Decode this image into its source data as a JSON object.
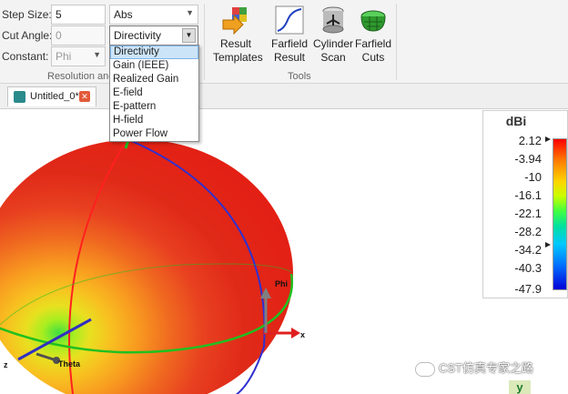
{
  "ribbon": {
    "step_size_label": "Step Size:",
    "step_size_value": "5",
    "cut_angle_label": "Cut Angle:",
    "cut_angle_value": "0",
    "constant_label": "Constant:",
    "constant_value": "Phi",
    "abs_value": "Abs",
    "quantity_value": "Directivity",
    "group_caption": "Resolution and",
    "tools_caption": "Tools",
    "tools": [
      {
        "label": "Result\nTemplates",
        "icon": "result-templates-icon"
      },
      {
        "label": "Farfield\nResult",
        "icon": "farfield-result-icon"
      },
      {
        "label": "Cylinder\nScan",
        "icon": "cylinder-scan-icon"
      },
      {
        "label": "Farfield\nCuts",
        "icon": "farfield-cuts-icon"
      }
    ]
  },
  "dropdown": {
    "options": [
      "Directivity",
      "Gain (IEEE)",
      "Realized Gain",
      "E-field",
      "E-pattern",
      "H-field",
      "Power Flow"
    ],
    "selected_index": 0
  },
  "tab": {
    "label": "Untitled_0*"
  },
  "colorbar": {
    "unit": "dBi",
    "ticks": [
      "2.12",
      "-3.94",
      "-10",
      "-16.1",
      "-22.1",
      "-28.2",
      "-34.2",
      "-40.3",
      "-47.9"
    ],
    "marker_value": "-34.2"
  },
  "viewport": {
    "axis_phi": "Phi",
    "axis_theta": "Theta",
    "axis_x": "x",
    "axis_z": "z",
    "axis_y": "y",
    "watermark": "CST仿真专家之路"
  },
  "colors": {
    "accent_select": "#cce4f7",
    "pattern_red": "#ff0000",
    "pattern_min": "#0000d8"
  }
}
